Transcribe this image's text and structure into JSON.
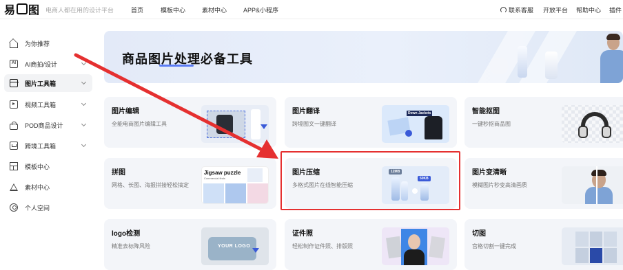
{
  "topbar": {
    "slogan": "电商人都在用的设计平台",
    "nav": [
      "首页",
      "模板中心",
      "素材中心",
      "APP&小程序"
    ],
    "right": [
      "联系客服",
      "开放平台",
      "帮助中心",
      "插件"
    ]
  },
  "sidebar": {
    "items": [
      {
        "label": "为你推荐",
        "icon": "home-icon"
      },
      {
        "label": "AI商拍/设计",
        "icon": "ai-icon"
      },
      {
        "label": "图片工具箱",
        "icon": "toolbox-icon"
      },
      {
        "label": "视频工具箱",
        "icon": "video-icon"
      },
      {
        "label": "POD商品设计",
        "icon": "bag-icon"
      },
      {
        "label": "跨境工具箱",
        "icon": "crossborder-icon"
      },
      {
        "label": "模板中心",
        "icon": "template-icon"
      },
      {
        "label": "素材中心",
        "icon": "material-icon"
      },
      {
        "label": "个人空间",
        "icon": "user-icon"
      }
    ]
  },
  "banner": {
    "title": "商品图片处理必备工具"
  },
  "cards": [
    {
      "title": "图片编辑",
      "desc": "全能电商图片编辑工具"
    },
    {
      "title": "图片翻译",
      "desc": "跨境图文一键翻译"
    },
    {
      "title": "智能抠图",
      "desc": "一键秒抠商品图"
    },
    {
      "title": "拼图",
      "desc": "网格、长图、海报拼接轻松搞定"
    },
    {
      "title": "图片压缩",
      "desc": "多格式图片在线智能压缩"
    },
    {
      "title": "图片变清晰",
      "desc": "模糊图片秒变高清画质"
    },
    {
      "title": "logo检测",
      "desc": "精准去标降风险"
    },
    {
      "title": "证件照",
      "desc": "轻松制作证件照、排版照"
    },
    {
      "title": "切图",
      "desc": "宫格切割一键完成"
    }
  ],
  "thumbs": {
    "translate_tag": "Down Jackets",
    "compress_before": "12MB",
    "compress_after": "50KB",
    "puzzle_title": "Jigsaw puzzle",
    "puzzle_sub": "Commercial finds",
    "logo_text": "YOUR LOGO"
  },
  "colors": {
    "accent": "#5b7cf6",
    "highlight_border": "#e53030",
    "arrow": "#e53030"
  }
}
